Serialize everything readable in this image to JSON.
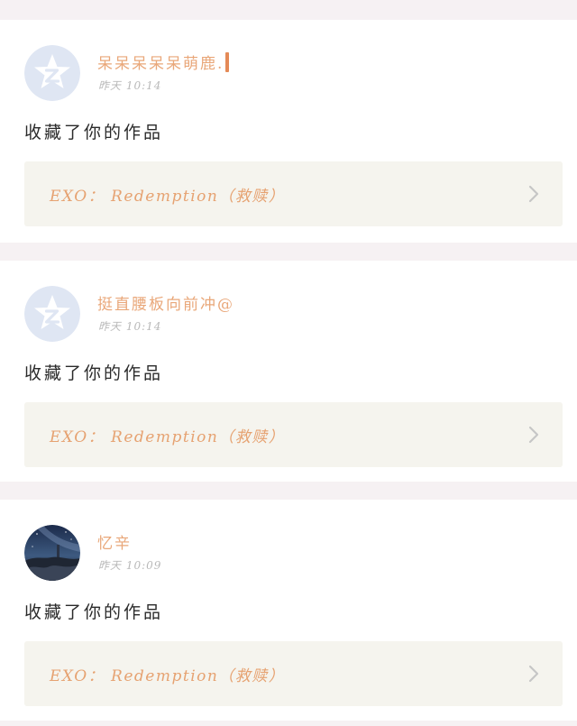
{
  "feed": {
    "items": [
      {
        "username": "呆呆呆呆呆萌鹿.",
        "time": "昨天 10:14",
        "action": "收藏了你的作品",
        "work_title": "EXO： Redemption（救赎）",
        "avatar": "qzone-default-icon"
      },
      {
        "username": "挺直腰板向前冲@",
        "time": "昨天 10:14",
        "action": "收藏了你的作品",
        "work_title": "EXO： Redemption（救赎）",
        "avatar": "qzone-default-icon"
      },
      {
        "username": "忆辛",
        "time": "昨天 10:09",
        "action": "收藏了你的作品",
        "work_title": "EXO： Redemption（救赎）",
        "avatar": "night-sky-photo"
      }
    ]
  },
  "colors": {
    "username": "#e9a779",
    "link_text": "#e6a271",
    "link_bg": "#f5f4ee",
    "avatar_default": "#dfe6f3",
    "time": "#b9b9b9"
  }
}
